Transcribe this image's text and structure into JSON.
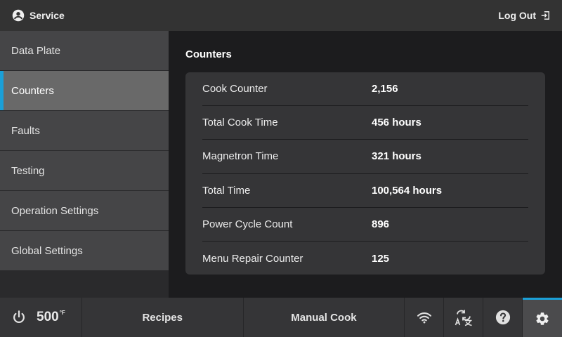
{
  "header": {
    "title": "Service",
    "user_icon": "account-circle-icon",
    "logout_label": "Log Out",
    "logout_icon": "logout-icon"
  },
  "sidebar": {
    "items": [
      {
        "label": "Data Plate",
        "active": false
      },
      {
        "label": "Counters",
        "active": true
      },
      {
        "label": "Faults",
        "active": false
      },
      {
        "label": "Testing",
        "active": false
      },
      {
        "label": "Operation Settings",
        "active": false
      },
      {
        "label": "Global Settings",
        "active": false
      }
    ]
  },
  "main": {
    "heading": "Counters",
    "rows": [
      {
        "label": "Cook Counter",
        "value": "2,156"
      },
      {
        "label": "Total Cook Time",
        "value": "456 hours"
      },
      {
        "label": "Magnetron Time",
        "value": "321 hours"
      },
      {
        "label": "Total Time",
        "value": "100,564 hours"
      },
      {
        "label": "Power Cycle Count",
        "value": "896"
      },
      {
        "label": "Menu Repair Counter",
        "value": "125"
      }
    ]
  },
  "footer": {
    "power_icon": "power-icon",
    "temperature": "500",
    "temperature_unit": "°F",
    "recipes_label": "Recipes",
    "manual_cook_label": "Manual Cook",
    "wifi_icon": "wifi-icon",
    "language_icon": "translate-icon",
    "help_icon": "help-icon",
    "settings_icon": "gear-icon"
  },
  "colors": {
    "accent": "#1ba0d8",
    "topbar": "#333333",
    "sidebar_item": "#454547",
    "sidebar_active": "#696969",
    "card": "#353537",
    "background": "#1c1c1e"
  }
}
